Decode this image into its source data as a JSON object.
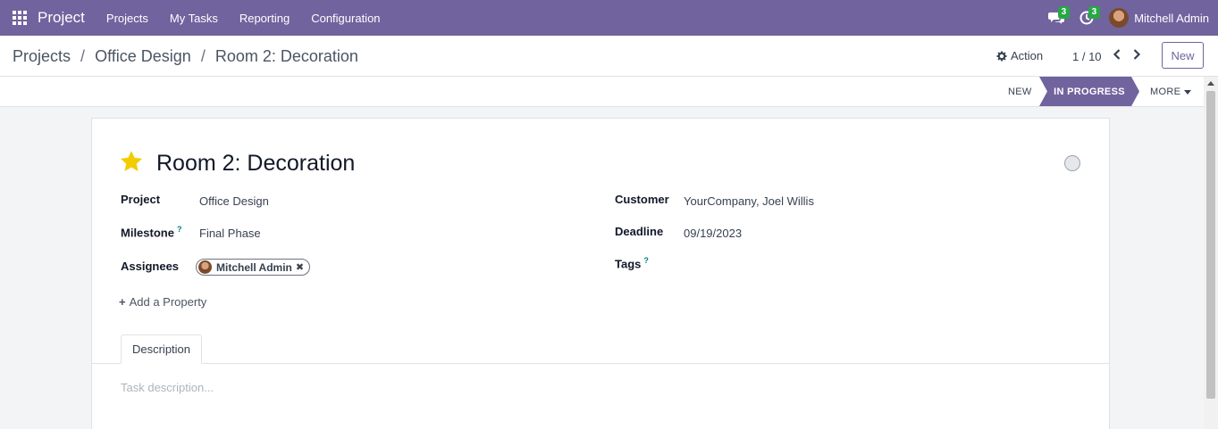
{
  "navbar": {
    "brand": "Project",
    "menu": [
      "Projects",
      "My Tasks",
      "Reporting",
      "Configuration"
    ],
    "messages_count": "3",
    "activities_count": "3",
    "user_name": "Mitchell Admin"
  },
  "control_panel": {
    "breadcrumb": [
      "Projects",
      "Office Design",
      "Room 2: Decoration"
    ],
    "action_label": "Action",
    "pager": "1 / 10",
    "new_label": "New"
  },
  "statusbar": {
    "stages": [
      "NEW",
      "IN PROGRESS"
    ],
    "active_stage": "IN PROGRESS",
    "more_label": "MORE"
  },
  "task": {
    "title": "Room 2: Decoration",
    "priority_starred": true,
    "fields": {
      "project_label": "Project",
      "project_value": "Office Design",
      "milestone_label": "Milestone",
      "milestone_value": "Final Phase",
      "assignees_label": "Assignees",
      "assignee": "Mitchell Admin",
      "customer_label": "Customer",
      "customer_value": "YourCompany, Joel Willis",
      "deadline_label": "Deadline",
      "deadline_value": "09/19/2023",
      "tags_label": "Tags"
    },
    "help_mark": "?",
    "add_property": "Add a Property",
    "tabs": [
      "Description"
    ],
    "description_placeholder": "Task description..."
  },
  "colors": {
    "primary": "#71639e",
    "badge": "#28a745",
    "star": "#f3cc00"
  }
}
